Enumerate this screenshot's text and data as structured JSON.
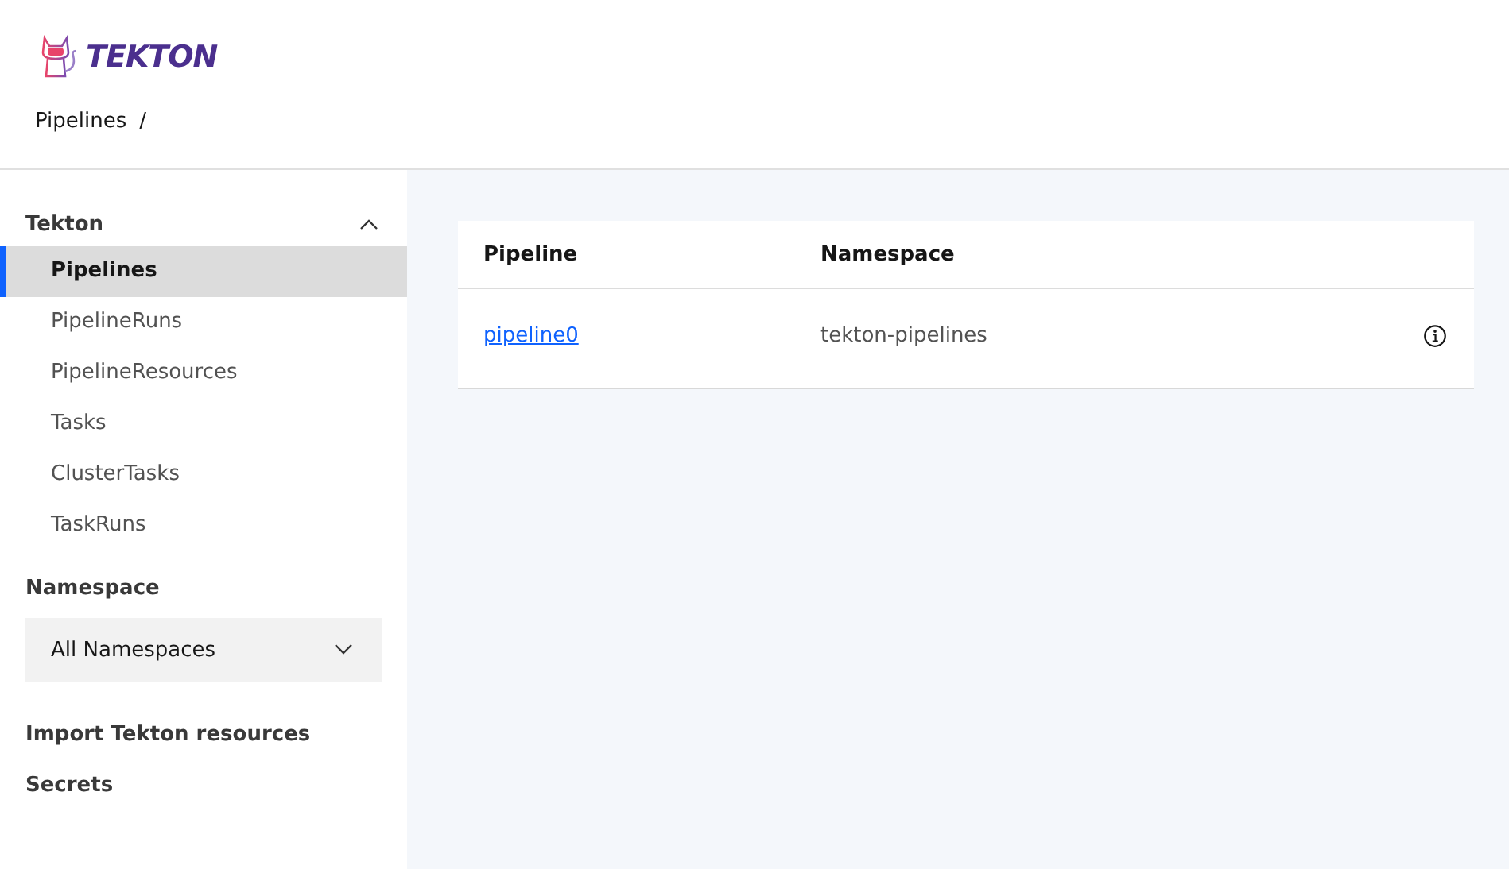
{
  "header": {
    "logo_text": "TEKTON",
    "breadcrumb": [
      "Pipelines"
    ],
    "breadcrumb_separator": "/"
  },
  "sidebar": {
    "section": {
      "label": "Tekton",
      "expanded": true,
      "items": [
        {
          "label": "Pipelines",
          "selected": true
        },
        {
          "label": "PipelineRuns",
          "selected": false
        },
        {
          "label": "PipelineResources",
          "selected": false
        },
        {
          "label": "Tasks",
          "selected": false
        },
        {
          "label": "ClusterTasks",
          "selected": false
        },
        {
          "label": "TaskRuns",
          "selected": false
        }
      ]
    },
    "namespace": {
      "label": "Namespace",
      "value": "All Namespaces"
    },
    "links": [
      "Import Tekton resources",
      "Secrets"
    ]
  },
  "table": {
    "columns": [
      "Pipeline",
      "Namespace"
    ],
    "rows": [
      {
        "pipeline": "pipeline0",
        "namespace": "tekton-pipelines"
      }
    ]
  }
}
